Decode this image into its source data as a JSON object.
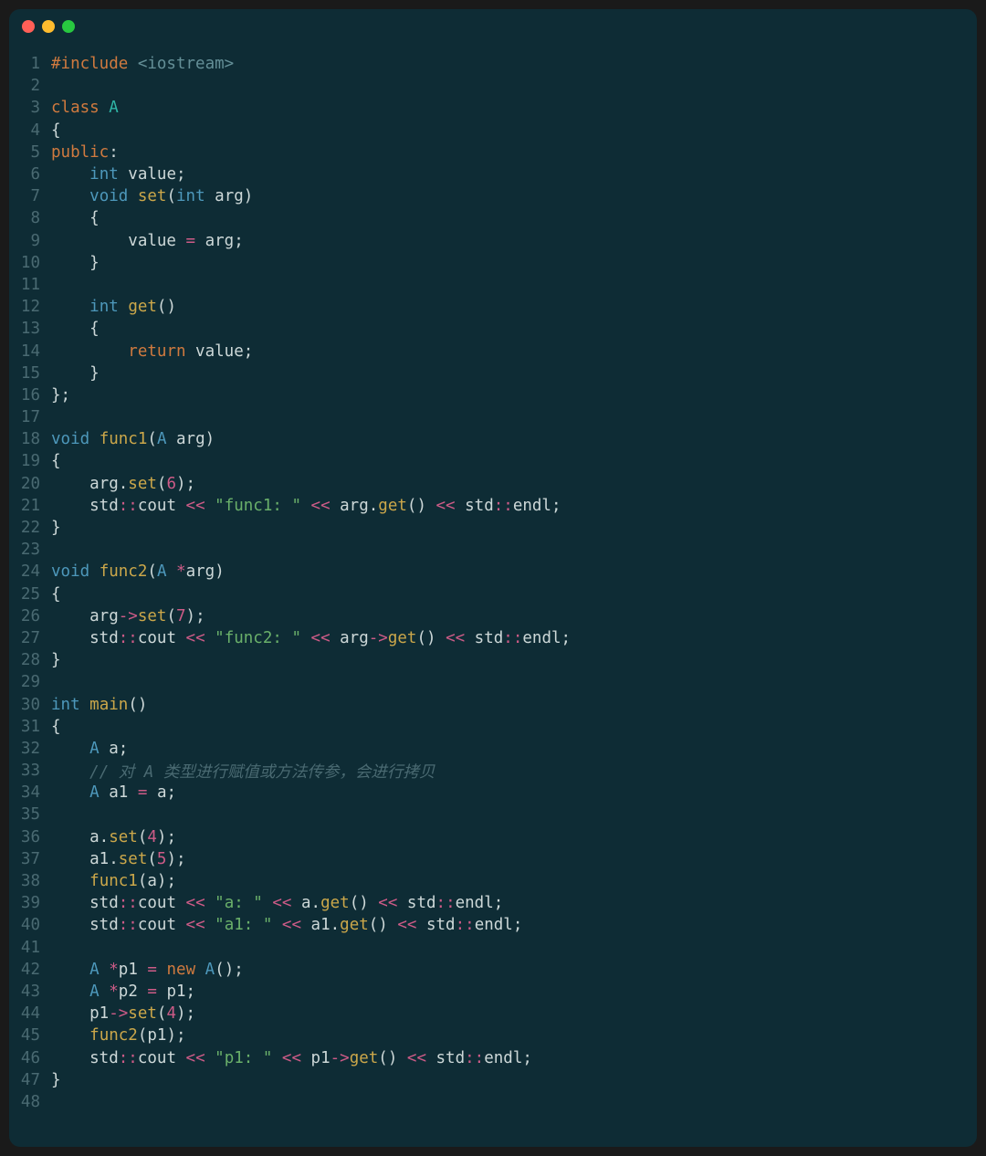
{
  "traffic_lights": [
    "red",
    "yellow",
    "green"
  ],
  "code": {
    "lines": [
      [
        {
          "t": "#include ",
          "c": "tk-preproc"
        },
        {
          "t": "<iostream>",
          "c": "tk-include-target"
        }
      ],
      [],
      [
        {
          "t": "class ",
          "c": "tk-keyword"
        },
        {
          "t": "A",
          "c": "tk-classname"
        }
      ],
      [
        {
          "t": "{",
          "c": "tk-punc"
        }
      ],
      [
        {
          "t": "public",
          "c": "tk-keyword"
        },
        {
          "t": ":",
          "c": "tk-punc"
        }
      ],
      [
        {
          "t": "    ",
          "c": ""
        },
        {
          "t": "int",
          "c": "tk-type"
        },
        {
          "t": " value;",
          "c": "tk-ident"
        }
      ],
      [
        {
          "t": "    ",
          "c": ""
        },
        {
          "t": "void",
          "c": "tk-type"
        },
        {
          "t": " ",
          "c": ""
        },
        {
          "t": "set",
          "c": "tk-func"
        },
        {
          "t": "(",
          "c": "tk-punc"
        },
        {
          "t": "int",
          "c": "tk-type"
        },
        {
          "t": " arg",
          "c": "tk-ident"
        },
        {
          "t": ")",
          "c": "tk-punc"
        }
      ],
      [
        {
          "t": "    {",
          "c": "tk-punc"
        }
      ],
      [
        {
          "t": "        value ",
          "c": "tk-ident"
        },
        {
          "t": "=",
          "c": "tk-op"
        },
        {
          "t": " arg;",
          "c": "tk-ident"
        }
      ],
      [
        {
          "t": "    }",
          "c": "tk-punc"
        }
      ],
      [],
      [
        {
          "t": "    ",
          "c": ""
        },
        {
          "t": "int",
          "c": "tk-type"
        },
        {
          "t": " ",
          "c": ""
        },
        {
          "t": "get",
          "c": "tk-func"
        },
        {
          "t": "()",
          "c": "tk-punc"
        }
      ],
      [
        {
          "t": "    {",
          "c": "tk-punc"
        }
      ],
      [
        {
          "t": "        ",
          "c": ""
        },
        {
          "t": "return",
          "c": "tk-keyword"
        },
        {
          "t": " value;",
          "c": "tk-ident"
        }
      ],
      [
        {
          "t": "    }",
          "c": "tk-punc"
        }
      ],
      [
        {
          "t": "};",
          "c": "tk-punc"
        }
      ],
      [],
      [
        {
          "t": "void",
          "c": "tk-type"
        },
        {
          "t": " ",
          "c": ""
        },
        {
          "t": "func1",
          "c": "tk-func"
        },
        {
          "t": "(",
          "c": "tk-punc"
        },
        {
          "t": "A",
          "c": "tk-type"
        },
        {
          "t": " arg",
          "c": "tk-ident"
        },
        {
          "t": ")",
          "c": "tk-punc"
        }
      ],
      [
        {
          "t": "{",
          "c": "tk-punc"
        }
      ],
      [
        {
          "t": "    arg.",
          "c": "tk-ident"
        },
        {
          "t": "set",
          "c": "tk-func"
        },
        {
          "t": "(",
          "c": "tk-punc"
        },
        {
          "t": "6",
          "c": "tk-num"
        },
        {
          "t": ");",
          "c": "tk-punc"
        }
      ],
      [
        {
          "t": "    std",
          "c": "tk-ident"
        },
        {
          "t": "::",
          "c": "tk-op"
        },
        {
          "t": "cout ",
          "c": "tk-ident"
        },
        {
          "t": "<<",
          "c": "tk-op"
        },
        {
          "t": " ",
          "c": ""
        },
        {
          "t": "\"func1: \"",
          "c": "tk-string"
        },
        {
          "t": " ",
          "c": ""
        },
        {
          "t": "<<",
          "c": "tk-op"
        },
        {
          "t": " arg.",
          "c": "tk-ident"
        },
        {
          "t": "get",
          "c": "tk-func"
        },
        {
          "t": "() ",
          "c": "tk-punc"
        },
        {
          "t": "<<",
          "c": "tk-op"
        },
        {
          "t": " std",
          "c": "tk-ident"
        },
        {
          "t": "::",
          "c": "tk-op"
        },
        {
          "t": "endl;",
          "c": "tk-ident"
        }
      ],
      [
        {
          "t": "}",
          "c": "tk-punc"
        }
      ],
      [],
      [
        {
          "t": "void",
          "c": "tk-type"
        },
        {
          "t": " ",
          "c": ""
        },
        {
          "t": "func2",
          "c": "tk-func"
        },
        {
          "t": "(",
          "c": "tk-punc"
        },
        {
          "t": "A",
          "c": "tk-type"
        },
        {
          "t": " ",
          "c": ""
        },
        {
          "t": "*",
          "c": "tk-op"
        },
        {
          "t": "arg",
          "c": "tk-ident"
        },
        {
          "t": ")",
          "c": "tk-punc"
        }
      ],
      [
        {
          "t": "{",
          "c": "tk-punc"
        }
      ],
      [
        {
          "t": "    arg",
          "c": "tk-ident"
        },
        {
          "t": "->",
          "c": "tk-op"
        },
        {
          "t": "set",
          "c": "tk-func"
        },
        {
          "t": "(",
          "c": "tk-punc"
        },
        {
          "t": "7",
          "c": "tk-num"
        },
        {
          "t": ");",
          "c": "tk-punc"
        }
      ],
      [
        {
          "t": "    std",
          "c": "tk-ident"
        },
        {
          "t": "::",
          "c": "tk-op"
        },
        {
          "t": "cout ",
          "c": "tk-ident"
        },
        {
          "t": "<<",
          "c": "tk-op"
        },
        {
          "t": " ",
          "c": ""
        },
        {
          "t": "\"func2: \"",
          "c": "tk-string"
        },
        {
          "t": " ",
          "c": ""
        },
        {
          "t": "<<",
          "c": "tk-op"
        },
        {
          "t": " arg",
          "c": "tk-ident"
        },
        {
          "t": "->",
          "c": "tk-op"
        },
        {
          "t": "get",
          "c": "tk-func"
        },
        {
          "t": "() ",
          "c": "tk-punc"
        },
        {
          "t": "<<",
          "c": "tk-op"
        },
        {
          "t": " std",
          "c": "tk-ident"
        },
        {
          "t": "::",
          "c": "tk-op"
        },
        {
          "t": "endl;",
          "c": "tk-ident"
        }
      ],
      [
        {
          "t": "}",
          "c": "tk-punc"
        }
      ],
      [],
      [
        {
          "t": "int",
          "c": "tk-type"
        },
        {
          "t": " ",
          "c": ""
        },
        {
          "t": "main",
          "c": "tk-func"
        },
        {
          "t": "()",
          "c": "tk-punc"
        }
      ],
      [
        {
          "t": "{",
          "c": "tk-punc"
        }
      ],
      [
        {
          "t": "    ",
          "c": ""
        },
        {
          "t": "A",
          "c": "tk-type"
        },
        {
          "t": " a;",
          "c": "tk-ident"
        }
      ],
      [
        {
          "t": "    ",
          "c": ""
        },
        {
          "t": "// 对 A 类型进行赋值或方法传参，会进行拷贝",
          "c": "tk-comment"
        }
      ],
      [
        {
          "t": "    ",
          "c": ""
        },
        {
          "t": "A",
          "c": "tk-type"
        },
        {
          "t": " a1 ",
          "c": "tk-ident"
        },
        {
          "t": "=",
          "c": "tk-op"
        },
        {
          "t": " a;",
          "c": "tk-ident"
        }
      ],
      [],
      [
        {
          "t": "    a.",
          "c": "tk-ident"
        },
        {
          "t": "set",
          "c": "tk-func"
        },
        {
          "t": "(",
          "c": "tk-punc"
        },
        {
          "t": "4",
          "c": "tk-num"
        },
        {
          "t": ");",
          "c": "tk-punc"
        }
      ],
      [
        {
          "t": "    a1.",
          "c": "tk-ident"
        },
        {
          "t": "set",
          "c": "tk-func"
        },
        {
          "t": "(",
          "c": "tk-punc"
        },
        {
          "t": "5",
          "c": "tk-num"
        },
        {
          "t": ");",
          "c": "tk-punc"
        }
      ],
      [
        {
          "t": "    ",
          "c": ""
        },
        {
          "t": "func1",
          "c": "tk-func"
        },
        {
          "t": "(a);",
          "c": "tk-punc"
        }
      ],
      [
        {
          "t": "    std",
          "c": "tk-ident"
        },
        {
          "t": "::",
          "c": "tk-op"
        },
        {
          "t": "cout ",
          "c": "tk-ident"
        },
        {
          "t": "<<",
          "c": "tk-op"
        },
        {
          "t": " ",
          "c": ""
        },
        {
          "t": "\"a: \"",
          "c": "tk-string"
        },
        {
          "t": " ",
          "c": ""
        },
        {
          "t": "<<",
          "c": "tk-op"
        },
        {
          "t": " a.",
          "c": "tk-ident"
        },
        {
          "t": "get",
          "c": "tk-func"
        },
        {
          "t": "() ",
          "c": "tk-punc"
        },
        {
          "t": "<<",
          "c": "tk-op"
        },
        {
          "t": " std",
          "c": "tk-ident"
        },
        {
          "t": "::",
          "c": "tk-op"
        },
        {
          "t": "endl;",
          "c": "tk-ident"
        }
      ],
      [
        {
          "t": "    std",
          "c": "tk-ident"
        },
        {
          "t": "::",
          "c": "tk-op"
        },
        {
          "t": "cout ",
          "c": "tk-ident"
        },
        {
          "t": "<<",
          "c": "tk-op"
        },
        {
          "t": " ",
          "c": ""
        },
        {
          "t": "\"a1: \"",
          "c": "tk-string"
        },
        {
          "t": " ",
          "c": ""
        },
        {
          "t": "<<",
          "c": "tk-op"
        },
        {
          "t": " a1.",
          "c": "tk-ident"
        },
        {
          "t": "get",
          "c": "tk-func"
        },
        {
          "t": "() ",
          "c": "tk-punc"
        },
        {
          "t": "<<",
          "c": "tk-op"
        },
        {
          "t": " std",
          "c": "tk-ident"
        },
        {
          "t": "::",
          "c": "tk-op"
        },
        {
          "t": "endl;",
          "c": "tk-ident"
        }
      ],
      [],
      [
        {
          "t": "    ",
          "c": ""
        },
        {
          "t": "A",
          "c": "tk-type"
        },
        {
          "t": " ",
          "c": ""
        },
        {
          "t": "*",
          "c": "tk-op"
        },
        {
          "t": "p1 ",
          "c": "tk-ident"
        },
        {
          "t": "=",
          "c": "tk-op"
        },
        {
          "t": " ",
          "c": ""
        },
        {
          "t": "new",
          "c": "tk-keyword"
        },
        {
          "t": " ",
          "c": ""
        },
        {
          "t": "A",
          "c": "tk-type"
        },
        {
          "t": "();",
          "c": "tk-punc"
        }
      ],
      [
        {
          "t": "    ",
          "c": ""
        },
        {
          "t": "A",
          "c": "tk-type"
        },
        {
          "t": " ",
          "c": ""
        },
        {
          "t": "*",
          "c": "tk-op"
        },
        {
          "t": "p2 ",
          "c": "tk-ident"
        },
        {
          "t": "=",
          "c": "tk-op"
        },
        {
          "t": " p1;",
          "c": "tk-ident"
        }
      ],
      [
        {
          "t": "    p1",
          "c": "tk-ident"
        },
        {
          "t": "->",
          "c": "tk-op"
        },
        {
          "t": "set",
          "c": "tk-func"
        },
        {
          "t": "(",
          "c": "tk-punc"
        },
        {
          "t": "4",
          "c": "tk-num"
        },
        {
          "t": ");",
          "c": "tk-punc"
        }
      ],
      [
        {
          "t": "    ",
          "c": ""
        },
        {
          "t": "func2",
          "c": "tk-func"
        },
        {
          "t": "(p1);",
          "c": "tk-punc"
        }
      ],
      [
        {
          "t": "    std",
          "c": "tk-ident"
        },
        {
          "t": "::",
          "c": "tk-op"
        },
        {
          "t": "cout ",
          "c": "tk-ident"
        },
        {
          "t": "<<",
          "c": "tk-op"
        },
        {
          "t": " ",
          "c": ""
        },
        {
          "t": "\"p1: \"",
          "c": "tk-string"
        },
        {
          "t": " ",
          "c": ""
        },
        {
          "t": "<<",
          "c": "tk-op"
        },
        {
          "t": " p1",
          "c": "tk-ident"
        },
        {
          "t": "->",
          "c": "tk-op"
        },
        {
          "t": "get",
          "c": "tk-func"
        },
        {
          "t": "() ",
          "c": "tk-punc"
        },
        {
          "t": "<<",
          "c": "tk-op"
        },
        {
          "t": " std",
          "c": "tk-ident"
        },
        {
          "t": "::",
          "c": "tk-op"
        },
        {
          "t": "endl;",
          "c": "tk-ident"
        }
      ],
      [
        {
          "t": "}",
          "c": "tk-punc"
        }
      ],
      []
    ]
  }
}
